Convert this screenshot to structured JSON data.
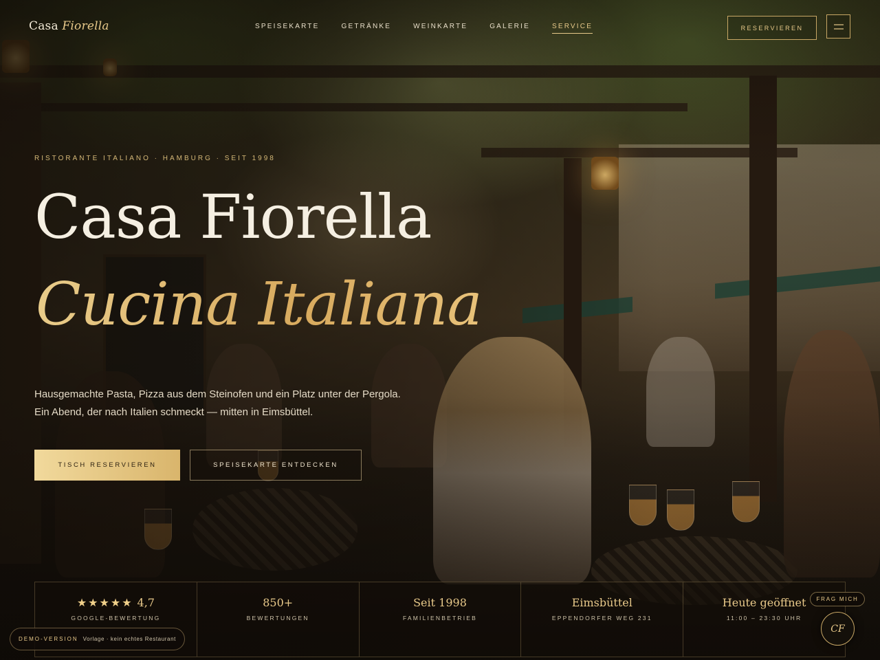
{
  "brand": {
    "name_plain": "Casa",
    "name_italic": "Fiorella"
  },
  "nav": {
    "items": [
      {
        "label": "SPEISEKARTE",
        "active": false
      },
      {
        "label": "GETRÄNKE",
        "active": false
      },
      {
        "label": "WEINKARTE",
        "active": false
      },
      {
        "label": "GALERIE",
        "active": false
      },
      {
        "label": "SERVICE",
        "active": true
      }
    ],
    "reserve_label": "RESERVIEREN",
    "menu_icon": "hamburger-icon"
  },
  "hero": {
    "eyebrow": "RISTORANTE ITALIANO · HAMBURG · SEIT 1998",
    "title": "Casa Fiorella",
    "subtitle": "Cucina Italiana",
    "description": "Hausgemachte Pasta, Pizza aus dem Steinofen und ein Platz unter der Pergola. Ein Abend, der nach Italien schmeckt — mitten in Eimsbüttel.",
    "primary_cta": "TISCH RESERVIEREN",
    "secondary_cta": "SPEISEKARTE ENTDECKEN"
  },
  "stats": [
    {
      "stars": "★★★★★",
      "value": "4,7",
      "label": "GOOGLE-BEWERTUNG"
    },
    {
      "value": "850+",
      "label": "BEWERTUNGEN"
    },
    {
      "value": "Seit 1998",
      "label": "FAMILIENBETRIEB"
    },
    {
      "value": "Eimsbüttel",
      "label": "EPPENDORFER WEG 231"
    },
    {
      "value": "Heute geöffnet",
      "label": "11:00 – 23:30 UHR"
    }
  ],
  "demo": {
    "title": "DEMO-VERSION",
    "text": "Vorlage · kein echtes Restaurant"
  },
  "assistant": {
    "pill_label": "FRAG MICH",
    "button_label": "CF"
  },
  "colors": {
    "accent_gold": "#e8c98a",
    "text_light": "#efe6d2",
    "background_dark": "#1d1710"
  }
}
